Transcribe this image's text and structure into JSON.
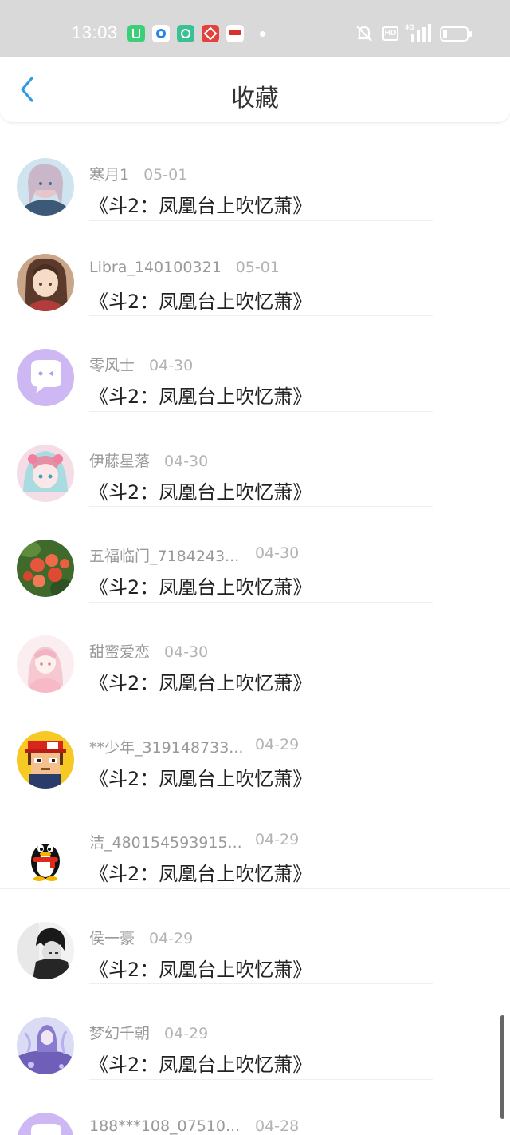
{
  "status_bar": {
    "time": "13:03",
    "network": "4G",
    "hd_label": "HD",
    "notification_apps": [
      "app-green-icon",
      "app-blue-icon",
      "app-teal-icon",
      "app-red-icon",
      "app-news-icon"
    ]
  },
  "header": {
    "title": "收藏",
    "back_icon": "chevron-left-icon"
  },
  "colors": {
    "accent": "#2f9be0",
    "status_bar_bg": "#d9d9d9",
    "default_avatar": "#cdb8f3"
  },
  "collections": [
    {
      "username": "寒月1",
      "date": "05-01",
      "message": "《斗2：凤凰台上吹忆萧》",
      "avatar": "anime-girl-blue"
    },
    {
      "username": "Libra_140100321",
      "date": "05-01",
      "message": "《斗2：凤凰台上吹忆萧》",
      "avatar": "anime-girl-brown"
    },
    {
      "username": "零风士",
      "date": "04-30",
      "message": "《斗2：凤凰台上吹忆萧》",
      "avatar": "default-chat-face"
    },
    {
      "username": "伊藤星落",
      "date": "04-30",
      "message": "《斗2：凤凰台上吹忆萧》",
      "avatar": "anime-girl-pink"
    },
    {
      "username": "五福临门_7184243...",
      "date": "04-30",
      "message": "《斗2：凤凰台上吹忆萧》",
      "avatar": "red-flowers"
    },
    {
      "username": "甜蜜爱恋",
      "date": "04-30",
      "message": "《斗2：凤凰台上吹忆萧》",
      "avatar": "anime-girl-light"
    },
    {
      "username": "**少年_319148733...",
      "date": "04-29",
      "message": "《斗2：凤凰台上吹忆萧》",
      "avatar": "pixel-boy"
    },
    {
      "username": "洁_480154593915...",
      "date": "04-29",
      "message": "《斗2：凤凰台上吹忆萧》",
      "avatar": "qq-penguin"
    },
    {
      "username": "侯一豪",
      "date": "04-29",
      "message": "《斗2：凤凰台上吹忆萧》",
      "avatar": "dark-anime-boy"
    },
    {
      "username": "梦幻千朝",
      "date": "04-29",
      "message": "《斗2：凤凰台上吹忆萧》",
      "avatar": "fantasy-purple"
    },
    {
      "username": "188***108_07510...",
      "date": "04-28",
      "message": "",
      "avatar": "default-chat-face"
    }
  ]
}
